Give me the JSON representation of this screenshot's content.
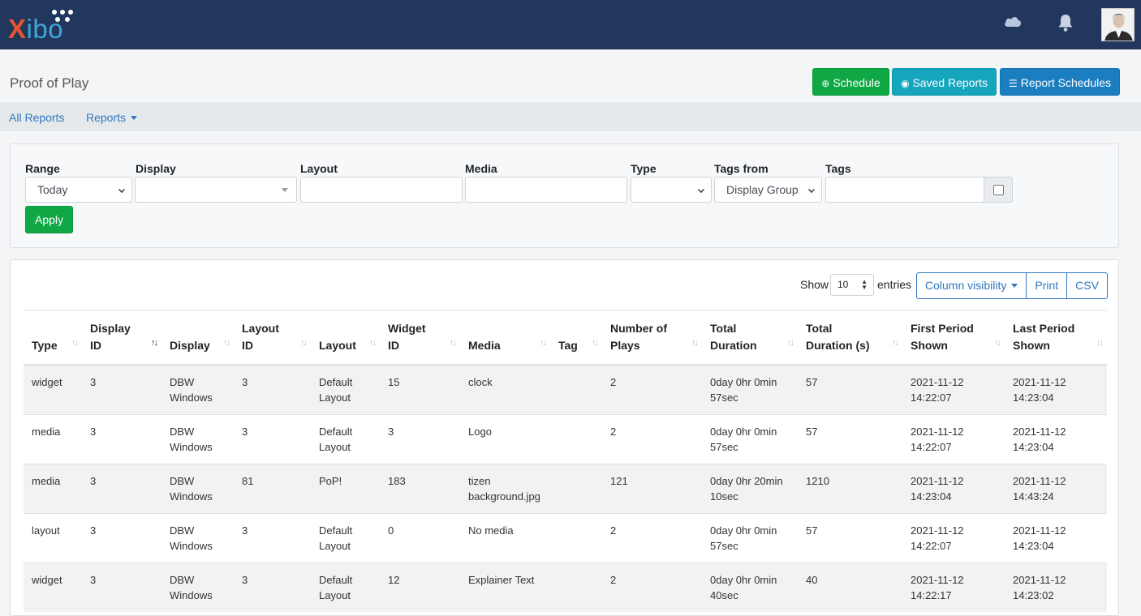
{
  "header": {
    "logo_text_x": "X",
    "logo_text_rest": "ibo"
  },
  "page": {
    "title": "Proof of Play",
    "buttons": {
      "schedule": "Schedule",
      "saved_reports": "Saved Reports",
      "report_schedules": "Report Schedules"
    }
  },
  "subnav": {
    "all_reports": "All Reports",
    "reports": "Reports"
  },
  "filters": {
    "range_label": "Range",
    "range_value": "Today",
    "display_label": "Display",
    "display_value": "",
    "layout_label": "Layout",
    "layout_value": "",
    "media_label": "Media",
    "media_value": "",
    "type_label": "Type",
    "type_value": "",
    "tags_from_label": "Tags from",
    "tags_from_value": "Display Group",
    "tags_label": "Tags",
    "tags_value": "",
    "apply": "Apply"
  },
  "table_controls": {
    "show": "Show",
    "length": "10",
    "entries": "entries",
    "column_visibility": "Column visibility",
    "print": "Print",
    "csv": "CSV"
  },
  "columns": [
    [
      "Type",
      ""
    ],
    [
      "Display",
      "ID"
    ],
    [
      "Display",
      ""
    ],
    [
      "Layout",
      "ID"
    ],
    [
      "Layout",
      ""
    ],
    [
      "Widget",
      "ID"
    ],
    [
      "Media",
      ""
    ],
    [
      "Tag",
      ""
    ],
    [
      "Number of",
      "Plays"
    ],
    [
      "Total",
      "Duration"
    ],
    [
      "Total",
      "Duration (s)"
    ],
    [
      "First Period",
      "Shown"
    ],
    [
      "Last Period",
      "Shown"
    ]
  ],
  "rows": [
    [
      [
        "widget"
      ],
      [
        "3"
      ],
      [
        "DBW",
        "Windows"
      ],
      [
        "3"
      ],
      [
        "Default",
        "Layout"
      ],
      [
        "15"
      ],
      [
        "clock"
      ],
      [
        ""
      ],
      [
        "2"
      ],
      [
        "0day 0hr 0min",
        "57sec"
      ],
      [
        "57"
      ],
      [
        "2021-11-12",
        "14:22:07"
      ],
      [
        "2021-11-12",
        "14:23:04"
      ]
    ],
    [
      [
        "media"
      ],
      [
        "3"
      ],
      [
        "DBW",
        "Windows"
      ],
      [
        "3"
      ],
      [
        "Default",
        "Layout"
      ],
      [
        "3"
      ],
      [
        "Logo"
      ],
      [
        ""
      ],
      [
        "2"
      ],
      [
        "0day 0hr 0min",
        "57sec"
      ],
      [
        "57"
      ],
      [
        "2021-11-12",
        "14:22:07"
      ],
      [
        "2021-11-12",
        "14:23:04"
      ]
    ],
    [
      [
        "media"
      ],
      [
        "3"
      ],
      [
        "DBW",
        "Windows"
      ],
      [
        "81"
      ],
      [
        "PoP!"
      ],
      [
        "183"
      ],
      [
        "tizen",
        "background.jpg"
      ],
      [
        ""
      ],
      [
        "121"
      ],
      [
        "0day 0hr 20min",
        "10sec"
      ],
      [
        "1210"
      ],
      [
        "2021-11-12",
        "14:23:04"
      ],
      [
        "2021-11-12",
        "14:43:24"
      ]
    ],
    [
      [
        "layout"
      ],
      [
        "3"
      ],
      [
        "DBW",
        "Windows"
      ],
      [
        "3"
      ],
      [
        "Default",
        "Layout"
      ],
      [
        "0"
      ],
      [
        "No media"
      ],
      [
        ""
      ],
      [
        "2"
      ],
      [
        "0day 0hr 0min",
        "57sec"
      ],
      [
        "57"
      ],
      [
        "2021-11-12",
        "14:22:07"
      ],
      [
        "2021-11-12",
        "14:23:04"
      ]
    ],
    [
      [
        "widget"
      ],
      [
        "3"
      ],
      [
        "DBW",
        "Windows"
      ],
      [
        "3"
      ],
      [
        "Default",
        "Layout"
      ],
      [
        "12"
      ],
      [
        "Explainer Text"
      ],
      [
        ""
      ],
      [
        "2"
      ],
      [
        "0day 0hr 0min",
        "40sec"
      ],
      [
        "40"
      ],
      [
        "2021-11-12",
        "14:22:17"
      ],
      [
        "2021-11-12",
        "14:23:02"
      ]
    ]
  ]
}
